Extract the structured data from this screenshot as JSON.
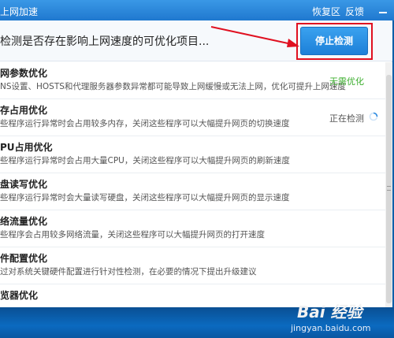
{
  "titlebar": {
    "title": "上网加速",
    "recover": "恢复区",
    "feedback": "反馈"
  },
  "header": {
    "status": "检测是否存在影响上网速度的可优化项目...",
    "stop_button": "停止检测"
  },
  "items": [
    {
      "name": "网参数优化",
      "desc": "NS设置、HOSTS和代理服务器参数异常都可能导致上网缓慢或无法上网，优化可提升上网速度",
      "state": "无需优化",
      "state_kind": "ok"
    },
    {
      "name": "存占用优化",
      "desc": "些程序运行异常时会占用较多内存，关闭这些程序可以大幅提升网页的切换速度",
      "state": "正在检测",
      "state_kind": "checking"
    },
    {
      "name": "PU占用优化",
      "desc": "些程序运行异常时会占用大量CPU，关闭这些程序可以大幅提升网页的刷新速度",
      "state": "",
      "state_kind": "none"
    },
    {
      "name": "盘读写优化",
      "desc": "些程序运行异常时会大量读写硬盘，关闭这些程序可以大幅提升网页的显示速度",
      "state": "",
      "state_kind": "none"
    },
    {
      "name": "络流量优化",
      "desc": "些程序会占用较多网络流量，关闭这些程序可以大幅提升网页的打开速度",
      "state": "",
      "state_kind": "none"
    },
    {
      "name": "件配置优化",
      "desc": "过对系统关键硬件配置进行针对性检测，在必要的情况下提出升级建议",
      "state": "",
      "state_kind": "none"
    },
    {
      "name": "览器优化",
      "desc": "",
      "state": "",
      "state_kind": "none"
    }
  ],
  "watermark": {
    "brand": "Bai 经验",
    "url": "jingyan.baidu.com"
  },
  "colors": {
    "accent": "#1d80d8",
    "ok": "#3cae2e",
    "highlight": "#e01020"
  }
}
